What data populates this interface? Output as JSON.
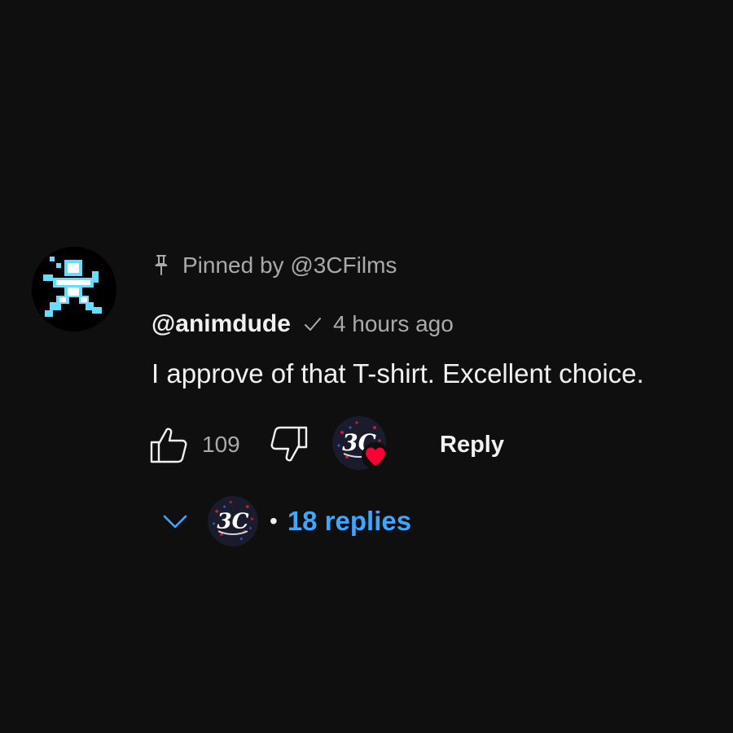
{
  "comment": {
    "pinned_text": "Pinned by @3CFilms",
    "author": "@animdude",
    "time": "4 hours ago",
    "text": "I approve of that T-shirt. Excellent choice.",
    "likes": "109",
    "reply_label": "Reply",
    "replies_label": "18 replies",
    "dot": "•"
  },
  "icons": {
    "pin": "pin-icon",
    "verified": "check-icon",
    "like": "thumbs-up-icon",
    "dislike": "thumbs-down-icon",
    "heart": "heart-icon",
    "chevron": "chevron-down-icon"
  },
  "colors": {
    "background": "#0f0f0f",
    "primary_text": "#f1f1f1",
    "secondary_text": "#aaaaaa",
    "link_blue": "#3ea6ff",
    "heart_red": "#ff0033",
    "avatar_cyan": "#66ddff"
  },
  "creator_avatar_text": "3C"
}
